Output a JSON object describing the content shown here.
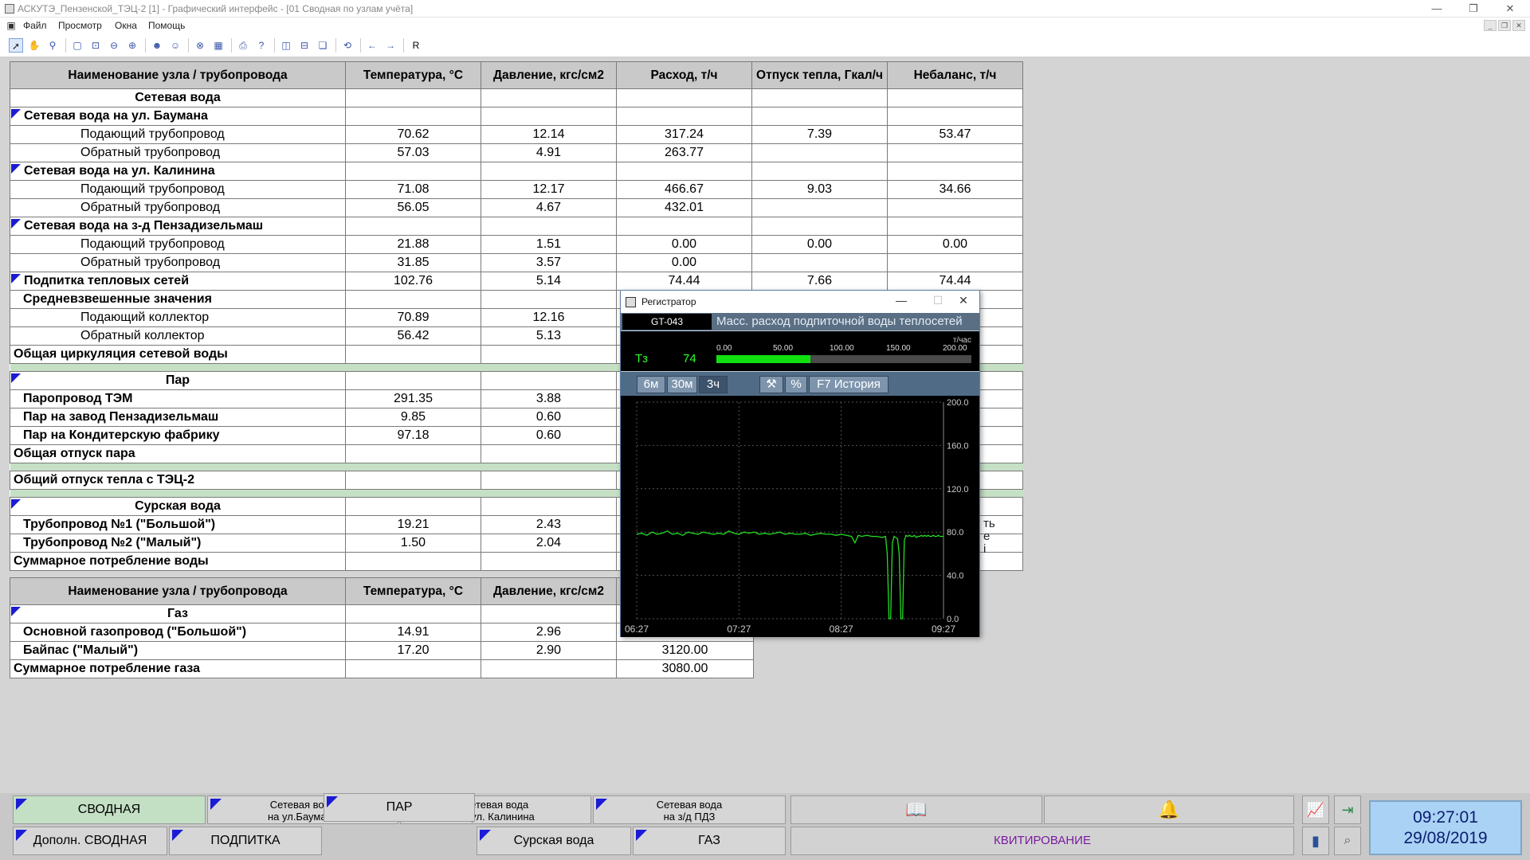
{
  "window": {
    "title": "АСКУТЭ_Пензенской_ТЭЦ-2 [1] - Графический интерфейс - [01 Сводная по узлам учёта]",
    "min_glyph": "—",
    "max_glyph": "❐",
    "close_glyph": "✕"
  },
  "menu": [
    "Файл",
    "Просмотр",
    "Окна",
    "Помощь"
  ],
  "toolbar": {
    "last_label": "R"
  },
  "table": {
    "headers": [
      "Наименование узла / трубопровода",
      "Температура, °C",
      "Давление, кгс/см2",
      "Расход, т/ч",
      "Отпуск тепла, Гкал/ч",
      "Небаланс, т/ч"
    ],
    "rows": {
      "s1": "Сетевая вода",
      "g1": "Сетевая вода на ул. Баумана",
      "g1a": {
        "name": "Подающий трубопровод",
        "t": "70.62",
        "p": "12.14",
        "f": "317.24",
        "q": "7.39",
        "n": "53.47"
      },
      "g1b": {
        "name": "Обратный трубопровод",
        "t": "57.03",
        "p": "4.91",
        "f": "263.77"
      },
      "g2": "Сетевая вода на ул. Калинина",
      "g2a": {
        "name": "Подающий трубопровод",
        "t": "71.08",
        "p": "12.17",
        "f": "466.67",
        "q": "9.03",
        "n": "34.66"
      },
      "g2b": {
        "name": "Обратный трубопровод",
        "t": "56.05",
        "p": "4.67",
        "f": "432.01"
      },
      "g3": "Сетевая вода на з-д Пензадизельмаш",
      "g3a": {
        "name": "Подающий трубопровод",
        "t": "21.88",
        "p": "1.51",
        "f": "0.00",
        "q": "0.00",
        "n": "0.00"
      },
      "g3b": {
        "name": "Обратный трубопровод",
        "t": "31.85",
        "p": "3.57",
        "f": "0.00"
      },
      "pod": {
        "name": "Подпитка тепловых сетей",
        "t": "102.76",
        "p": "5.14",
        "f": "74.44",
        "q": "7.66",
        "n": "74.44"
      },
      "avg": "Средневзвешенные значения",
      "avga": {
        "name": "Подающий коллектор",
        "t": "70.89",
        "p": "12.16"
      },
      "avgb": {
        "name": "Обратный коллектор",
        "t": "56.42",
        "p": "5.13"
      },
      "circ": "Общая циркуляция сетевой воды",
      "s2": "Пар",
      "par1": {
        "name": "Паропровод ТЭМ",
        "t": "291.35",
        "p": "3.88"
      },
      "par2": {
        "name": "Пар на завод Пензадизельмаш",
        "t": "9.85",
        "p": "0.60"
      },
      "par3": {
        "name": "Пар на Кондитерскую фабрику",
        "t": "97.18",
        "p": "0.60"
      },
      "partot": "Общая отпуск пара",
      "heattot": "Общий отпуск тепла с ТЭЦ-2",
      "s3": "Сурская вода",
      "sur1": {
        "name": "Трубопровод №1 (\"Большой\")",
        "t": "19.21",
        "p": "2.43"
      },
      "sur2": {
        "name": "Трубопровод №2 (\"Малый\")",
        "t": "1.50",
        "p": "2.04"
      },
      "surtot": "Суммарное потребление воды"
    }
  },
  "side_note": "ть\nе\nі",
  "gas": {
    "headers": [
      "Наименование узла / трубопровода",
      "Температура, °C",
      "Давление, кгс/см2",
      ""
    ],
    "section": "Газ",
    "r1": {
      "name": "Основной газопровод (\"Большой\")",
      "t": "14.91",
      "p": "2.96",
      "f": ""
    },
    "r2": {
      "name": "Байпас (\"Малый\")",
      "t": "17.20",
      "p": "2.90",
      "f": "3120.00"
    },
    "tot": {
      "name": "Суммарное потребление газа",
      "f": "3080.00"
    }
  },
  "recorder": {
    "title": "Регистратор",
    "tag": "GT-043",
    "description": "Масс. расход подпиточной воды теплосетей",
    "var": "Тз",
    "value": "74",
    "unit": "т/час",
    "scale_labels": [
      "0.00",
      "50.00",
      "100.00",
      "150.00",
      "200.00"
    ],
    "bar_fraction": 0.37,
    "range_buttons": [
      "6м",
      "30м",
      "3ч"
    ],
    "active_range": 2,
    "btn_percent": "%",
    "btn_history": "F7 История",
    "y_labels": [
      "200.0",
      "160.0",
      "120.0",
      "80.0",
      "40.0",
      "0.0"
    ],
    "x_labels": [
      "06:27",
      "07:27",
      "08:27",
      "09:27"
    ]
  },
  "chart_data": {
    "type": "line",
    "title": "",
    "xlabel": "",
    "ylabel": "",
    "ylim": [
      0,
      200
    ],
    "xlim": [
      0,
      180
    ],
    "x_tick_labels": [
      "06:27",
      "07:27",
      "08:27",
      "09:27"
    ],
    "y_tick_labels": [
      "200.0",
      "160.0",
      "120.0",
      "80.0",
      "40.0",
      "0.0"
    ],
    "grid": true,
    "series": [
      {
        "color": "#22dd22",
        "x": [
          0,
          3,
          6,
          9,
          12,
          15,
          18,
          21,
          24,
          27,
          30,
          33,
          36,
          39,
          42,
          45,
          48,
          51,
          54,
          57,
          60,
          63,
          66,
          69,
          72,
          75,
          78,
          81,
          84,
          87,
          90,
          93,
          96,
          99,
          102,
          105,
          108,
          111,
          114,
          117,
          120,
          123,
          126,
          128,
          130,
          132,
          135,
          138,
          141,
          144,
          146,
          147,
          148,
          149,
          150,
          151,
          152,
          153,
          154,
          155,
          156,
          157,
          158,
          159,
          160,
          161,
          162,
          163,
          164,
          165,
          166,
          167,
          168,
          169,
          170,
          171,
          172,
          173,
          174,
          175,
          176,
          177,
          178,
          180
        ],
        "y": [
          78,
          79,
          77,
          80,
          78,
          79,
          81,
          78,
          79,
          77,
          80,
          79,
          78,
          80,
          79,
          78,
          79,
          78,
          81,
          79,
          78,
          80,
          79,
          80,
          78,
          79,
          78,
          79,
          80,
          78,
          79,
          78,
          78,
          79,
          77,
          78,
          79,
          78,
          78,
          77,
          78,
          77,
          76,
          70,
          77,
          76,
          77,
          76,
          76,
          75,
          76,
          60,
          0,
          0,
          70,
          76,
          75,
          74,
          60,
          0,
          0,
          72,
          77,
          76,
          77,
          76,
          76,
          77,
          75,
          76,
          76,
          77,
          76,
          77,
          76,
          77,
          76,
          76,
          77,
          76,
          76,
          77,
          76,
          76
        ]
      }
    ]
  },
  "nav": {
    "row1": [
      {
        "label": "СВОДНАЯ"
      },
      {
        "label": "Сетевая вода",
        "label2": "на ул.Баумана"
      },
      {
        "label": "Сетевая вода",
        "label2": "на ул. Калинина"
      },
      {
        "label": "Сетевая вода",
        "label2": "на з/д ПДЗ"
      }
    ],
    "row2": [
      {
        "label": "Дополн. СВОДНАЯ"
      },
      {
        "label": "ПОДПИТКА"
      },
      {
        "label": "ПАР"
      },
      {
        "label": "Сурская вода"
      },
      {
        "label": "ГАЗ"
      }
    ],
    "kvit": "КВИТИРОВАНИЕ"
  },
  "clock": {
    "time": "09:27:01",
    "date": "29/08/2019"
  }
}
